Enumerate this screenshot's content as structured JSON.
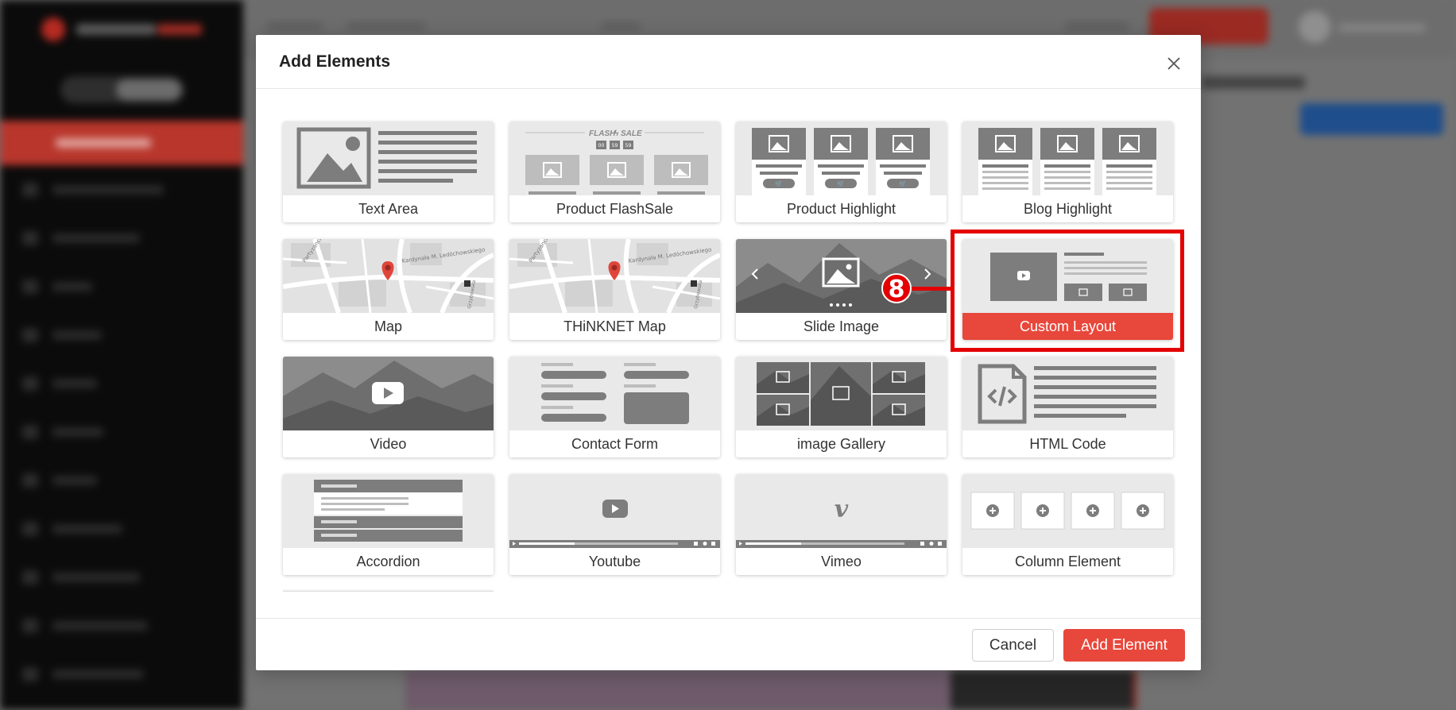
{
  "modal": {
    "title": "Add Elements",
    "cancel_label": "Cancel",
    "add_label": "Add Element"
  },
  "elements": [
    {
      "label": "Text Area",
      "icon": "text-area-thumbnail"
    },
    {
      "label": "Product FlashSale",
      "icon": "product-flashsale-thumbnail",
      "thumb_text": {
        "flash": "FLASH",
        "sale": "SALE",
        "timer": [
          "00",
          "59",
          "59"
        ]
      }
    },
    {
      "label": "Product Highlight",
      "icon": "product-highlight-thumbnail"
    },
    {
      "label": "Blog Highlight",
      "icon": "blog-highlight-thumbnail"
    },
    {
      "label": "Map",
      "icon": "map-thumbnail",
      "thumb_text": {
        "street1": "Kardynała M. Ledóchowskiego",
        "street2": "Partyzancka",
        "street3": "Grzybowska"
      }
    },
    {
      "label": "THiNKNET Map",
      "icon": "thinknet-map-thumbnail",
      "thumb_text": {
        "street1": "Kardynała M. Ledóchowskiego",
        "street2": "Partyzancka",
        "street3": "Grzybowska"
      }
    },
    {
      "label": "Slide Image",
      "icon": "slide-image-thumbnail"
    },
    {
      "label": "Custom Layout",
      "icon": "custom-layout-thumbnail",
      "selected": true
    },
    {
      "label": "Video",
      "icon": "video-thumbnail"
    },
    {
      "label": "Contact Form",
      "icon": "contact-form-thumbnail"
    },
    {
      "label": "image Gallery",
      "icon": "image-gallery-thumbnail"
    },
    {
      "label": "HTML Code",
      "icon": "html-code-thumbnail"
    },
    {
      "label": "Accordion",
      "icon": "accordion-thumbnail"
    },
    {
      "label": "Youtube",
      "icon": "youtube-thumbnail"
    },
    {
      "label": "Vimeo",
      "icon": "vimeo-thumbnail"
    },
    {
      "label": "Column Element",
      "icon": "column-element-thumbnail"
    }
  ],
  "annotation": {
    "step": "8"
  },
  "colors": {
    "accent": "#e8473b",
    "highlight": "#e40000",
    "sidebar": "#0b0b0b",
    "thumb_bg": "#e9e9e9",
    "thumb_dark": "#7d7d7d"
  }
}
